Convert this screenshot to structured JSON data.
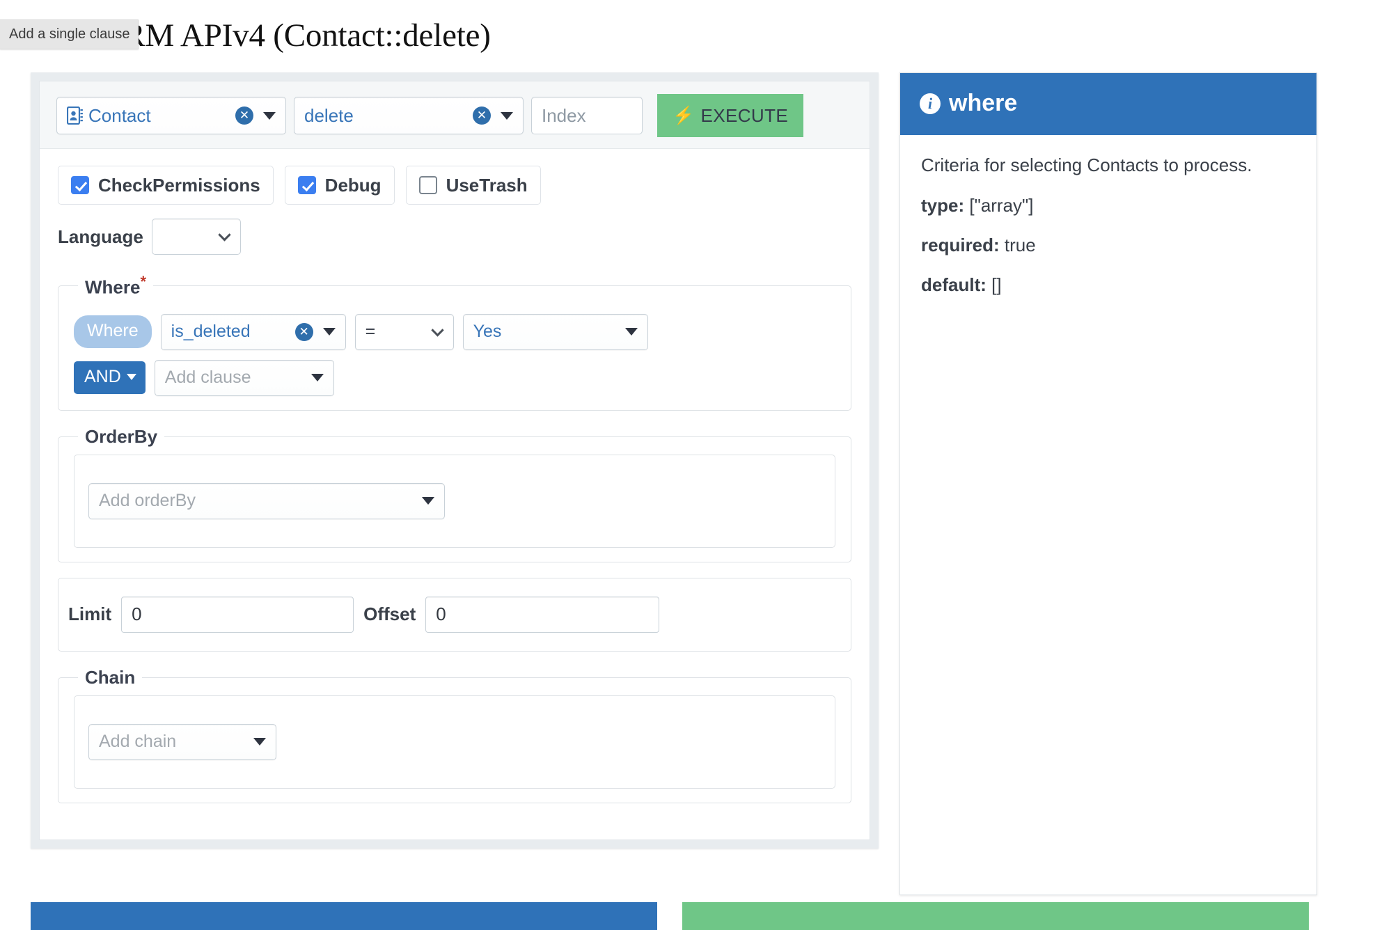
{
  "page": {
    "title": "CiviCRM APIv4 (Contact::delete)",
    "tooltip": "Add a single clause"
  },
  "action_bar": {
    "entity": {
      "value": "Contact",
      "icon": "contact-card-icon"
    },
    "action": {
      "value": "delete"
    },
    "index": {
      "value": "",
      "placeholder": "Index"
    },
    "execute": {
      "label": "EXECUTE",
      "icon": "bolt-icon"
    }
  },
  "options": {
    "checkboxes": [
      {
        "label": "CheckPermissions",
        "checked": true
      },
      {
        "label": "Debug",
        "checked": true
      },
      {
        "label": "UseTrash",
        "checked": false
      }
    ],
    "language": {
      "label": "Language",
      "value": ""
    }
  },
  "where": {
    "legend": "Where",
    "required_marker": "*",
    "clauses": [
      {
        "conjunction": "Where",
        "field": "is_deleted",
        "operator": "=",
        "value": "Yes"
      }
    ],
    "add": {
      "conjunction": "AND",
      "placeholder": "Add clause"
    }
  },
  "order_by": {
    "legend": "OrderBy",
    "add_placeholder": "Add orderBy"
  },
  "limits": {
    "limit_label": "Limit",
    "limit_value": "0",
    "offset_label": "Offset",
    "offset_value": "0"
  },
  "chain": {
    "legend": "Chain",
    "add_placeholder": "Add chain"
  },
  "help_panel": {
    "title": "where",
    "icon": "info-icon",
    "description": "Criteria for selecting Contacts to process.",
    "type_label": "type:",
    "type_value": "[\"array\"]",
    "required_label": "required:",
    "required_value": "true",
    "default_label": "default:",
    "default_value": "[]"
  },
  "colors": {
    "accent_blue": "#2f72b8",
    "accent_green": "#6fc687",
    "checkbox_blue": "#3b7ef0",
    "pill_light_blue": "#a8c7e8",
    "required_red": "#c0392b"
  }
}
